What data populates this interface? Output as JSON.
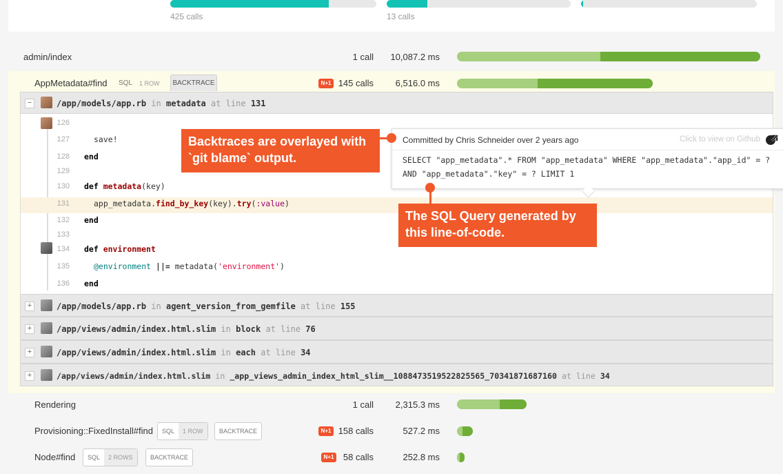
{
  "top_panel": {
    "metrics": [
      {
        "calls": "425 calls",
        "fraction": 0.77
      },
      {
        "calls": "13 calls",
        "fraction": 0.22
      },
      {
        "calls": "",
        "fraction": 0.01
      }
    ]
  },
  "rows": {
    "admin_index": {
      "label": "admin/index",
      "calls": "1 call",
      "time": "10,087.2 ms",
      "light_fraction": 0.47,
      "total_fraction": 1.0
    },
    "appmetadata": {
      "label": "AppMetadata#find",
      "tag_sql": "SQL",
      "tag_rows": "1 ROW",
      "backtrace": "BACKTRACE",
      "n1": "N+1",
      "calls": "145 calls",
      "time": "6,516.0 ms"
    },
    "rendering": {
      "label": "Rendering",
      "calls": "1 call",
      "time": "2,315.3 ms"
    },
    "provisioning": {
      "label": "Provisioning::FixedInstall#find",
      "tag_sql": "SQL",
      "tag_rows": "1 ROW",
      "backtrace": "BACKTRACE",
      "n1": "N+1",
      "calls": "158 calls",
      "time": "527.2 ms"
    },
    "node": {
      "label": "Node#find",
      "tag_sql": "SQL",
      "tag_rows": "2 ROWS",
      "backtrace": "BACKTRACE",
      "n1": "N+1",
      "calls": "58 calls",
      "time": "252.8 ms"
    }
  },
  "backtrace": {
    "in": "in",
    "at_line": "at line",
    "frames": [
      {
        "toggle": "−",
        "path": "/app/models/app.rb",
        "method": "metadata",
        "line": "131"
      },
      {
        "toggle": "+",
        "path": "/app/models/app.rb",
        "method": "agent_version_from_gemfile",
        "line": "155"
      },
      {
        "toggle": "+",
        "path": "/app/views/admin/index.html.slim",
        "method": "block",
        "line": "76"
      },
      {
        "toggle": "+",
        "path": "/app/views/admin/index.html.slim",
        "method": "each",
        "line": "34"
      },
      {
        "toggle": "+",
        "path": "/app/views/admin/index.html.slim",
        "method": "_app_views_admin_index_html_slim__1088473519522825565_70341871687160",
        "line": "34"
      }
    ]
  },
  "code": {
    "lines": [
      {
        "n": "126"
      },
      {
        "n": "127",
        "t1": "save!"
      },
      {
        "n": "128",
        "t1": "end"
      },
      {
        "n": "129"
      },
      {
        "n": "130",
        "kw": "def ",
        "name": "metadata",
        "rest": "(key)"
      },
      {
        "n": "131",
        "a": "app_metadata.",
        "b": "find_by_key",
        "c": "(key).",
        "d": "try",
        "e": "(",
        "f": ":value",
        "g": ")"
      },
      {
        "n": "132",
        "t1": "end"
      },
      {
        "n": "133"
      },
      {
        "n": "134",
        "kw": "def ",
        "name": "environment"
      },
      {
        "n": "135",
        "iv": "@environment",
        "op": " ||= ",
        "m": "metadata(",
        "s": "'environment'",
        "cl": ")"
      },
      {
        "n": "136",
        "t1": "end"
      }
    ]
  },
  "tooltip": {
    "committed": "Committed by Chris Schneider over 2 years ago",
    "github": "Click to view on Github",
    "sql_line1": "SELECT \"app_metadata\".* FROM \"app_metadata\" WHERE \"app_metadata\".\"app_id\" = ?",
    "sql_line2": "AND \"app_metadata\".\"key\" = ? LIMIT 1"
  },
  "callouts": {
    "blame_line1": "Backtraces are overlayed with",
    "blame_line2": "`git blame` output.",
    "sql_line1": "The SQL Query generated by",
    "sql_line2": "this line-of-code."
  },
  "colors": {
    "accent": "#f0592a",
    "teal": "#12c3b5",
    "green_light": "#a6cf7e",
    "green_dark": "#6eae38",
    "highlight": "#fdfce8"
  }
}
